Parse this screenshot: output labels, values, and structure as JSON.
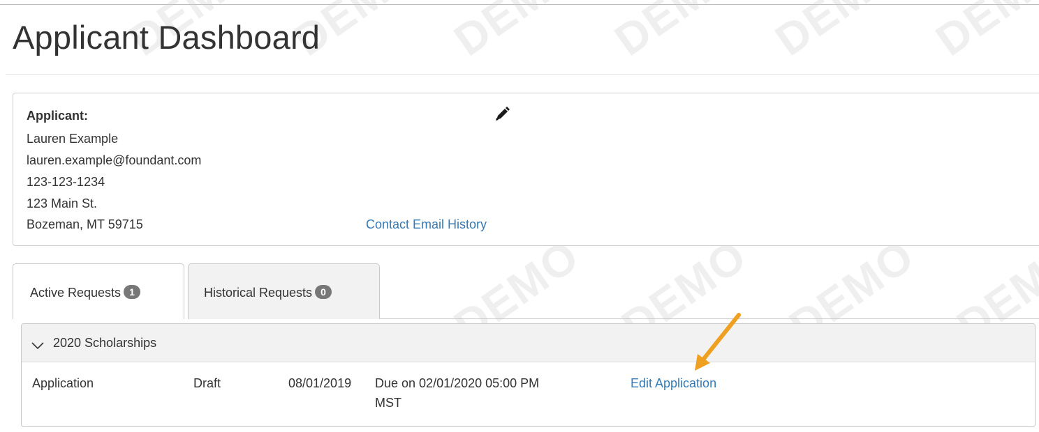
{
  "page": {
    "title": "Applicant Dashboard"
  },
  "watermark": {
    "text": "DEMO"
  },
  "applicant": {
    "label": "Applicant:",
    "name": "Lauren Example",
    "email": "lauren.example@foundant.com",
    "phone": "123-123-1234",
    "street": "123 Main St.",
    "city_line": "Bozeman, MT 59715",
    "contact_link": "Contact Email History",
    "edit_icon": "pencil-icon"
  },
  "tabs": [
    {
      "label": "Active Requests",
      "count": "1",
      "active": true
    },
    {
      "label": "Historical Requests",
      "count": "0",
      "active": false
    }
  ],
  "group": {
    "title": "2020 Scholarships",
    "toggle_icon": "chevron-down-icon",
    "rows": [
      {
        "type": "Application",
        "status": "Draft",
        "date": "08/01/2019",
        "due_line1": "Due on 02/01/2020 05:00 PM",
        "due_line2": "MST",
        "action": "Edit Application"
      }
    ]
  },
  "colors": {
    "link": "#337ab7",
    "badge": "#777777",
    "arrow": "#f0a020"
  }
}
